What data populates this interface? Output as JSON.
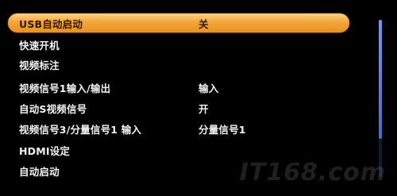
{
  "menu": {
    "items": [
      {
        "label": "USB自动启动",
        "value": "关",
        "selected": true
      },
      {
        "label": "快速开机",
        "value": ""
      },
      {
        "label": "视频标注",
        "value": ""
      },
      {
        "label": "视频信号1输入/输出",
        "value": "输入"
      },
      {
        "label": "自动S视频信号",
        "value": "开"
      },
      {
        "label": "视频信号3/分量信号1 输入",
        "value": "分量信号1"
      },
      {
        "label": "HDMI设定",
        "value": ""
      },
      {
        "label": "自动启动",
        "value": ""
      }
    ]
  },
  "watermark": "IT168.com",
  "colors": {
    "background": "#000000",
    "highlight": "#f5a53a",
    "text": "#f2f2f2",
    "scrollbar": "#4f7fd8"
  }
}
